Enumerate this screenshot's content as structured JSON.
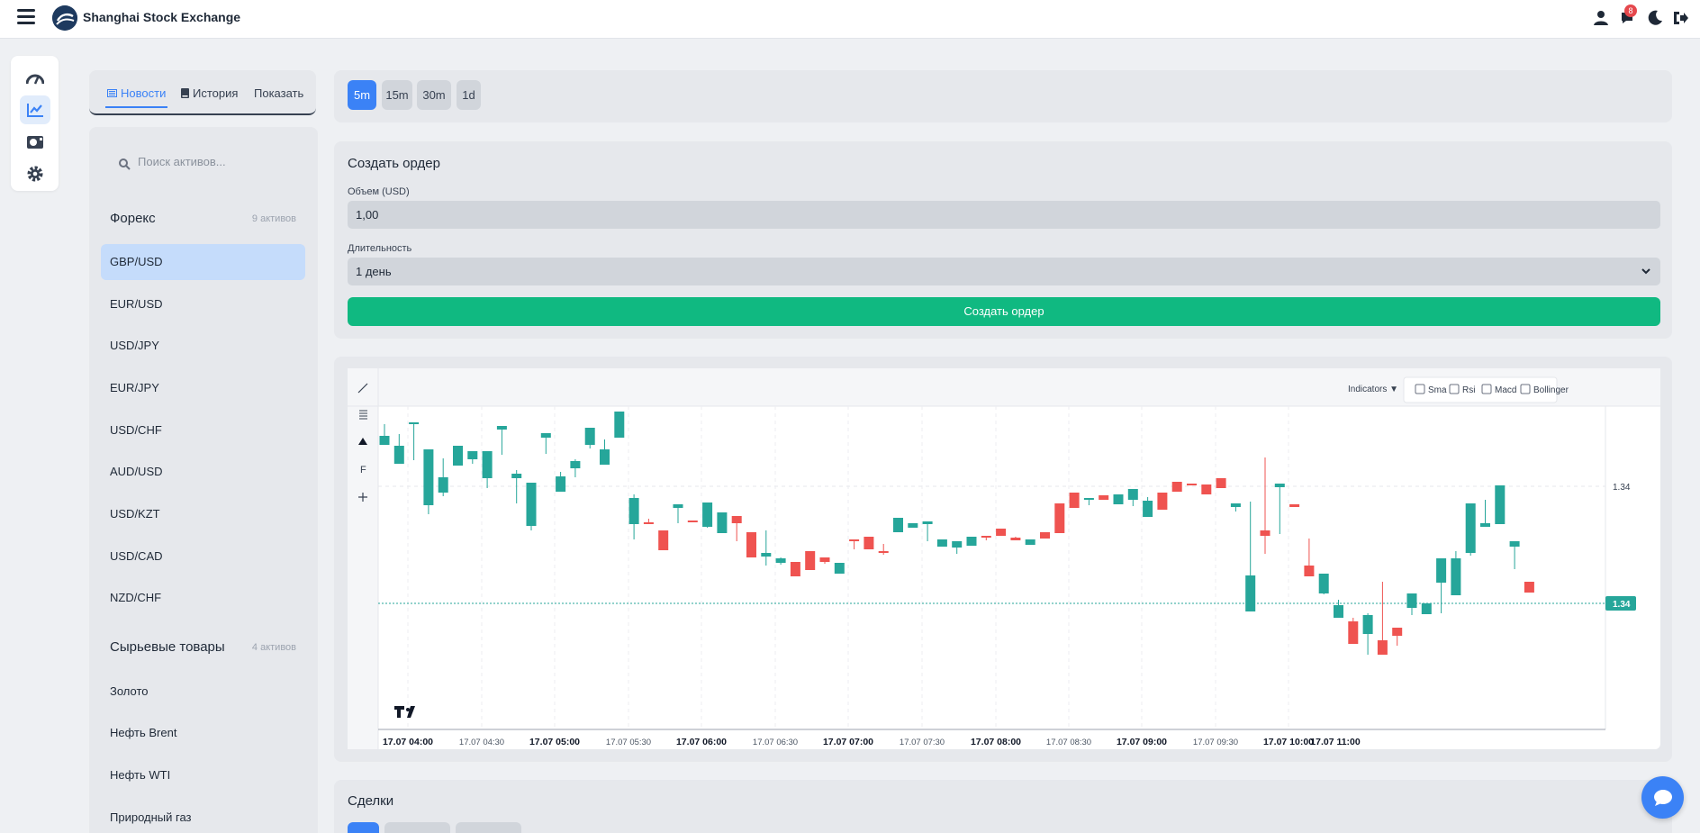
{
  "app": {
    "brand": "Shanghai Stock Exchange"
  },
  "topbar": {
    "notifications_count": "8",
    "icons": [
      "user-icon",
      "bell-icon",
      "moon-icon",
      "logout-icon"
    ]
  },
  "rail": {
    "items": [
      {
        "icon": "dashboard-icon",
        "active": false
      },
      {
        "icon": "chart-line-icon",
        "active": true
      },
      {
        "icon": "camera-icon",
        "active": false
      },
      {
        "icon": "gear-icon",
        "active": false
      }
    ]
  },
  "sidebar": {
    "tabs": [
      {
        "label": "Новости",
        "icon": "newspaper-icon",
        "active": true
      },
      {
        "label": "История",
        "icon": "book-icon",
        "active": false
      },
      {
        "label": "Показать",
        "active": false
      }
    ],
    "search_placeholder": "Поиск активов...",
    "groups": [
      {
        "title": "Форекс",
        "count": "9 активов",
        "items": [
          "GBP/USD",
          "EUR/USD",
          "USD/JPY",
          "EUR/JPY",
          "USD/CHF",
          "AUD/USD",
          "USD/KZT",
          "USD/CAD",
          "NZD/CHF"
        ],
        "selected": "GBP/USD"
      },
      {
        "title": "Сырьевые товары",
        "count": "4 активов",
        "items": [
          "Золото",
          "Нефть Brent",
          "Нефть WTI",
          "Природный газ"
        ]
      }
    ]
  },
  "timeframes": {
    "options": [
      "5m",
      "15m",
      "30m",
      "1d"
    ],
    "selected": "5m"
  },
  "order": {
    "title": "Создать ордер",
    "volume_label": "Объем (USD)",
    "volume_value": "1,00",
    "duration_label": "Длительность",
    "duration_value": "1 день",
    "submit_label": "Создать ордер"
  },
  "chart": {
    "indicators_label": "Indicators ▼",
    "indicators": [
      "Sma",
      "Rsi",
      "Macd",
      "Bollinger"
    ],
    "price_tick": "1.34",
    "last_price": "1.34",
    "tools": [
      "trend-line-icon",
      "horizontal-lines-icon",
      "triangle-icon",
      "fib-icon",
      "plus-icon"
    ],
    "colors": {
      "up": "#26a69a",
      "down": "#ef5350"
    }
  },
  "chart_data": {
    "type": "candlestick",
    "title": "",
    "x_ticks": [
      {
        "label": "17.07 04:00",
        "major": true
      },
      {
        "label": "17.07 04:30",
        "major": false
      },
      {
        "label": "17.07 05:00",
        "major": true
      },
      {
        "label": "17.07 05:30",
        "major": false
      },
      {
        "label": "17.07 06:00",
        "major": true
      },
      {
        "label": "17.07 06:30",
        "major": false
      },
      {
        "label": "17.07 07:00",
        "major": true
      },
      {
        "label": "17.07 07:30",
        "major": false
      },
      {
        "label": "17.07 08:00",
        "major": true
      },
      {
        "label": "17.07 08:30",
        "major": false
      },
      {
        "label": "17.07 09:00",
        "major": true
      },
      {
        "label": "17.07 09:30",
        "major": false
      },
      {
        "label": "17.07 10:00",
        "major": true
      },
      {
        "label": "17.07 11:00",
        "major": true
      }
    ],
    "y_ticks": [
      "1.34"
    ],
    "last_value_label": "1.34",
    "candles": [
      [
        20,
        43,
        33,
        41
      ],
      [
        31,
        64,
        44,
        56
      ],
      [
        55,
        20,
        18,
        60
      ],
      [
        55,
        110,
        48,
        120
      ],
      [
        58,
        96,
        79,
        100
      ],
      [
        59,
        66,
        44,
        63
      ],
      [
        88,
        59,
        50,
        64
      ],
      [
        57,
        80,
        50,
        91
      ],
      [
        42,
        26,
        22,
        54
      ],
      [
        71,
        80,
        75,
        108
      ],
      [
        92,
        133,
        85,
        138
      ],
      [
        50,
        35,
        30,
        53
      ],
      [
        73,
        95,
        78,
        95
      ],
      [
        59,
        69,
        61,
        79
      ],
      [
        48,
        43,
        24,
        47
      ],
      [
        37,
        65,
        48,
        61
      ],
      [
        12,
        35,
        6,
        35
      ],
      [
        98,
        131,
        102,
        148
      ],
      [
        125,
        129,
        131,
        127
      ],
      [
        139,
        138,
        160,
        112
      ],
      [
        143,
        113,
        109,
        130
      ],
      [
        156,
        127,
        128,
        121
      ],
      [
        124,
        134,
        107,
        135
      ],
      [
        126,
        141,
        118,
        135
      ],
      [
        133,
        122,
        130,
        150
      ],
      [
        154,
        140,
        168,
        154
      ],
      [
        138,
        167,
        163,
        177
      ],
      [
        168,
        174,
        169,
        176
      ],
      [
        190,
        173,
        189,
        179
      ],
      [
        187,
        161,
        182,
        158
      ],
      [
        190,
        168,
        173,
        175
      ],
      [
        181,
        186,
        174,
        155
      ],
      [
        166,
        148,
        148,
        159
      ],
      [
        169,
        145,
        159,
        146
      ],
      [
        153,
        161,
        162,
        165
      ],
      [
        124,
        140,
        124,
        127
      ],
      [
        130,
        135,
        130,
        135
      ],
      [
        147,
        131,
        128,
        150
      ],
      [
        150,
        156,
        148,
        154
      ],
      [
        152,
        157,
        150,
        164
      ],
      [
        150,
        155,
        145,
        147
      ],
      [
        149,
        144,
        144,
        149
      ],
      [
        146,
        136,
        144,
        144
      ],
      [
        145,
        146,
        149,
        146
      ],
      [
        148,
        154,
        148,
        143
      ],
      [
        147,
        140,
        147,
        141
      ],
      [
        137,
        108,
        141,
        101
      ],
      [
        109,
        96,
        113,
        92
      ],
      [
        107,
        104,
        102,
        110
      ],
      [
        105,
        99,
        104,
        98
      ],
      [
        102,
        109,
        98,
        108
      ],
      [
        97,
        104,
        92,
        111
      ],
      [
        101,
        123,
        105,
        121
      ],
      [
        115,
        96,
        115,
        90
      ],
      [
        95,
        84,
        95,
        82
      ],
      [
        87,
        86,
        86,
        84
      ],
      [
        94,
        87,
        98,
        96
      ],
      [
        93,
        80,
        91,
        75
      ],
      [
        110,
        112,
        108,
        117
      ],
      [
        106,
        228,
        188,
        224
      ],
      [
        57,
        138,
        144,
        164
      ],
      [
        133,
        90,
        86,
        142
      ],
      [
        172,
        109,
        112,
        104
      ],
      [
        147,
        177,
        189,
        186
      ],
      [
        188,
        208,
        186,
        209
      ],
      [
        215,
        235,
        221,
        233
      ],
      [
        235,
        239,
        264,
        217
      ],
      [
        230,
        253,
        232,
        276
      ],
      [
        195,
        260,
        276,
        236
      ],
      [
        258,
        246,
        255,
        266
      ],
      [
        236,
        224,
        208,
        232
      ],
      [
        225,
        231,
        219,
        218
      ],
      [
        220,
        196,
        169,
        230
      ],
      [
        161,
        210,
        169,
        167
      ],
      [
        126,
        163,
        108,
        166
      ],
      [
        104,
        134,
        130,
        117
      ],
      [
        121,
        131,
        88,
        117
      ],
      [
        159,
        156,
        150,
        181
      ],
      [
        202,
        195,
        207,
        191
      ]
    ]
  },
  "deals": {
    "title": "Сделки"
  }
}
